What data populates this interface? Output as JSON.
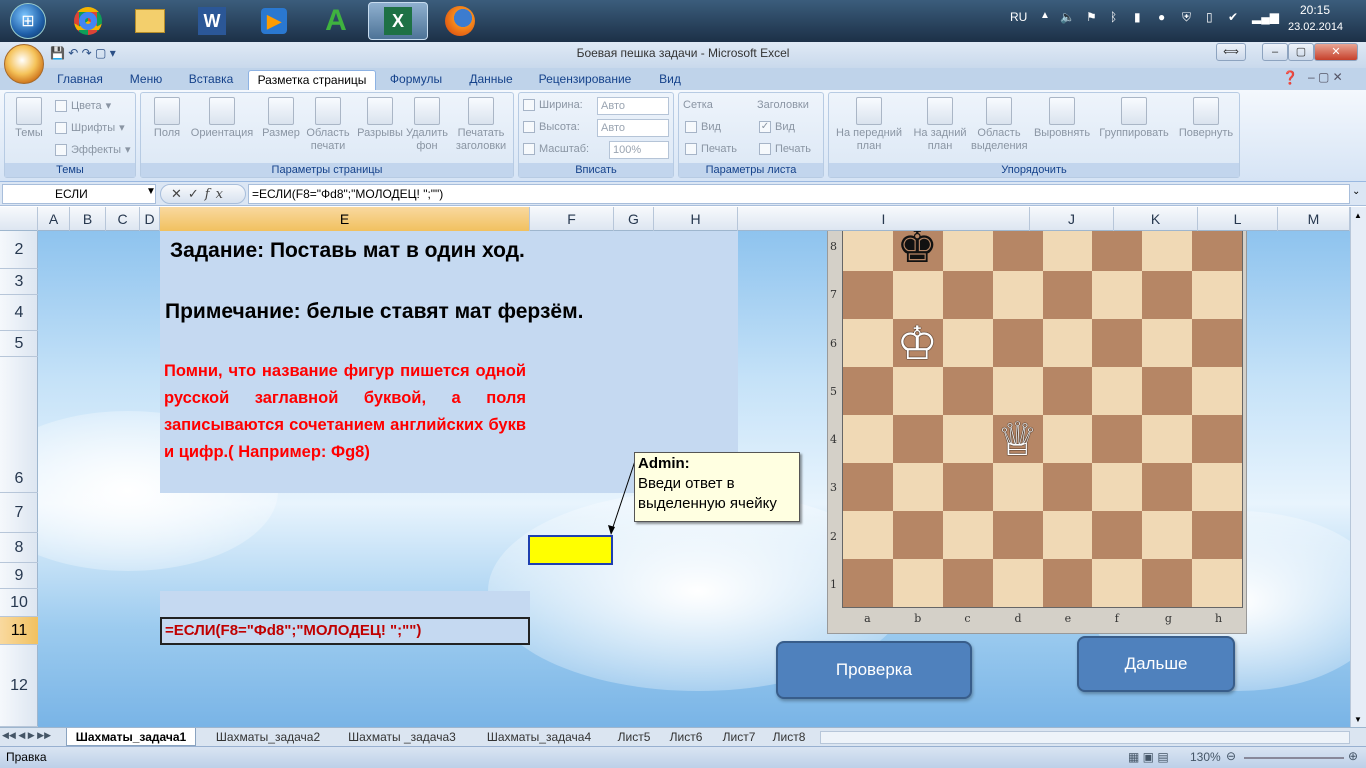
{
  "taskbar": {
    "apps": [
      "chrome-icon",
      "explorer-icon",
      "word-icon",
      "media-icon",
      "green-a-icon",
      "excel-icon",
      "firefox-icon"
    ],
    "lang": "RU",
    "time": "20:15",
    "date": "23.02.2014"
  },
  "window": {
    "title": "Боевая пешка задачи - Microsoft Excel"
  },
  "ribbon_tabs": [
    "Главная",
    "Меню",
    "Вставка",
    "Разметка страницы",
    "Формулы",
    "Данные",
    "Рецензирование",
    "Вид"
  ],
  "ribbon_selected": "Разметка страницы",
  "ribbon": {
    "themes": {
      "big": "Темы",
      "colors": "Цвета",
      "fonts": "Шрифты",
      "effects": "Эффекты",
      "title": "Темы"
    },
    "page_setup": {
      "buttons": [
        "Поля",
        "Ориентация",
        "Размер",
        "Область печати",
        "Разрывы",
        "Удалить фон",
        "Печатать заголовки"
      ],
      "title": "Параметры страницы"
    },
    "fit": {
      "width_label": "Ширина:",
      "width_value": "Авто",
      "height_label": "Высота:",
      "height_value": "Авто",
      "scale_label": "Масштаб:",
      "scale_value": "100%",
      "title": "Вписать"
    },
    "sheet_options": {
      "grid": "Сетка",
      "headings": "Заголовки",
      "view": "Вид",
      "print": "Печать",
      "title": "Параметры листа"
    },
    "arrange": {
      "buttons": [
        "На передний план",
        "На задний план",
        "Область выделения",
        "Выровнять",
        "Группировать",
        "Повернуть"
      ],
      "title": "Упорядочить"
    }
  },
  "formula_bar": {
    "name_box": "ЕСЛИ",
    "formula": "=ЕСЛИ(F8=\"Фd8\";\"МОЛОДЕЦ! \";\"\")"
  },
  "columns": [
    "A",
    "B",
    "C",
    "D",
    "E",
    "F",
    "G",
    "H",
    "I",
    "J",
    "K",
    "L",
    "M"
  ],
  "rows": [
    "2",
    "3",
    "4",
    "5",
    "6",
    "7",
    "8",
    "9",
    "10",
    "11",
    "12"
  ],
  "content": {
    "task": "Задание: Поставь мат в один  ход.",
    "note": "Примечание:  белые ставят мат ферзём.",
    "hint": "Помни, что название фигур пишется одной русской заглавной буквой, а поля записываются сочетанием английских букв и цифр.( Например: Фg8)",
    "formula_cell": "=ЕСЛИ(F8=\"Фd8\";\"МОЛОДЕЦ! \";\"\")"
  },
  "comment": {
    "author": "Admin:",
    "text": "Введи ответ в выделенную ячейку"
  },
  "chessboard": {
    "ranks": [
      "8",
      "7",
      "6",
      "5",
      "4",
      "3",
      "2",
      "1"
    ],
    "files": [
      "a",
      "b",
      "c",
      "d",
      "e",
      "f",
      "g",
      "h"
    ],
    "pieces": [
      {
        "piece": "black-king",
        "glyph": "♚",
        "square": "b8"
      },
      {
        "piece": "white-king",
        "glyph": "♔",
        "square": "b6"
      },
      {
        "piece": "white-queen",
        "glyph": "♕",
        "square": "d4"
      }
    ]
  },
  "buttons": {
    "check": "Проверка",
    "next": "Дальше"
  },
  "sheet_tabs": [
    "Шахматы_задача1",
    "Шахматы_задача2",
    "Шахматы _задача3",
    "Шахматы_задача4",
    "Лист5",
    "Лист6",
    "Лист7",
    "Лист8"
  ],
  "status": {
    "mode": "Правка",
    "zoom": "130%"
  }
}
